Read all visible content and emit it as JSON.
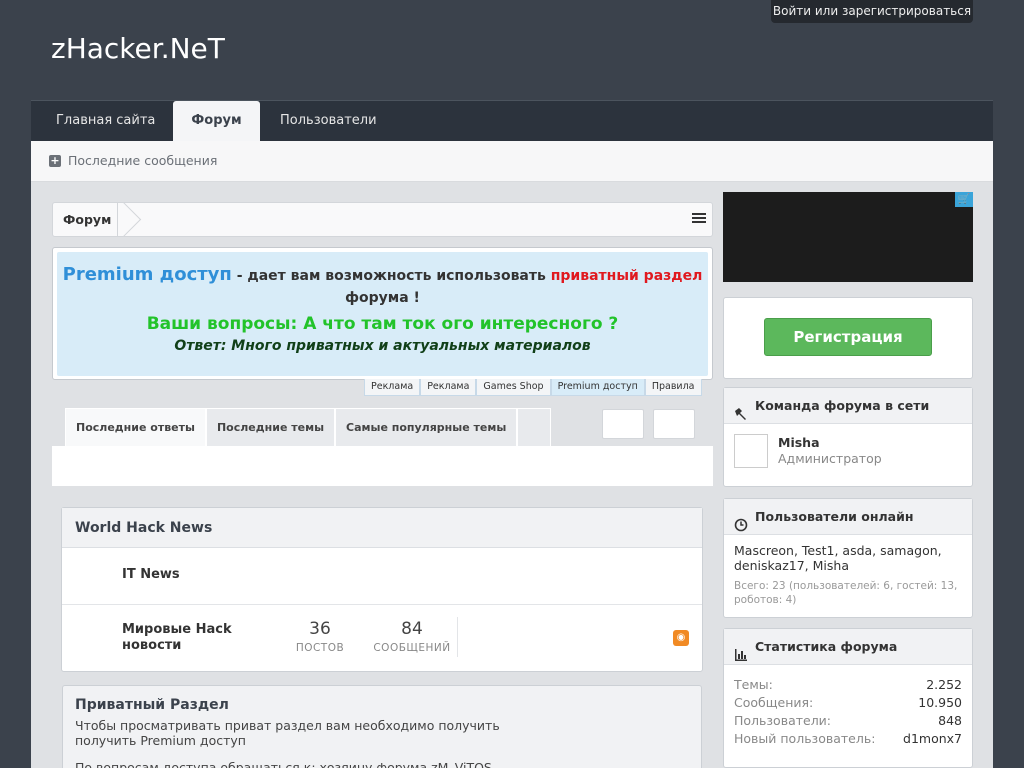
{
  "header": {
    "logo": "zHacker.NeT",
    "login": "Войти или зарегистрироваться"
  },
  "nav": {
    "tabs": [
      {
        "label": "Главная сайта"
      },
      {
        "label": "Форум"
      },
      {
        "label": "Пользователи"
      }
    ]
  },
  "subnav": {
    "recent": "Последние сообщения"
  },
  "breadcrumb": {
    "label": "Форум"
  },
  "promo": {
    "premium": "Premium доступ",
    "text1": " - дает вам возможность использовать ",
    "private": "приватный раздел",
    "text2": " форума !",
    "question": "Ваши вопросы: А что там ток ого интересного ?",
    "answer": "Ответ: Много приватных и актуальных материалов"
  },
  "adtabs": [
    "Реклама",
    "Реклама",
    "Games Shop",
    "Premium доступ",
    "Правила"
  ],
  "recent_tabs": [
    "Последние ответы",
    "Последние темы",
    "Самые популярные темы"
  ],
  "category": {
    "title": "World Hack News",
    "forums": [
      {
        "title": "IT News"
      },
      {
        "title": "Мировые Hack новости",
        "posts": "36",
        "posts_label": "ПОСТОВ",
        "messages": "84",
        "messages_label": "СООБЩЕНИЙ"
      }
    ]
  },
  "private": {
    "title": "Приватный Раздел",
    "desc": "Чтобы просматривать приват раздел вам необходимо получить получить Premium доступ",
    "desc2": "По вопросам доступа обращаться к: хозяину форума zM_ViTOS"
  },
  "sidebar": {
    "register": "Регистрация",
    "team": {
      "title": "Команда форума в сети",
      "name": "Misha",
      "role": "Администратор"
    },
    "online": {
      "title": "Пользователи онлайн",
      "list": "Mascreon, Test1, asda, samagon, deniskaz17, Misha",
      "count": "Всего: 23 (пользователей: 6, гостей: 13, роботов: 4)"
    },
    "stats": {
      "title": "Статистика форума",
      "rows": [
        {
          "k": "Темы:",
          "v": "2.252"
        },
        {
          "k": "Сообщения:",
          "v": "10.950"
        },
        {
          "k": "Пользователи:",
          "v": "848"
        },
        {
          "k": "Новый пользователь:",
          "v": "d1monx7"
        }
      ]
    }
  },
  "colors": {
    "header_bg": "#3b424c",
    "nav_bg": "#2c333d",
    "premium_blue": "#2f8fd8",
    "private_red": "#e0191f",
    "question_green": "#22c32a",
    "register_green": "#5cb85c"
  }
}
